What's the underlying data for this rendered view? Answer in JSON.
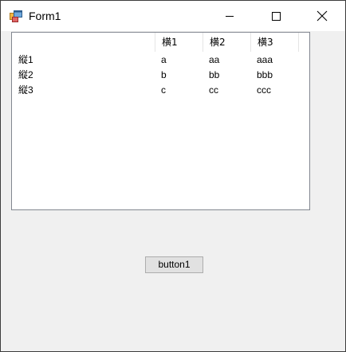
{
  "window": {
    "title": "Form1"
  },
  "listview": {
    "columns": [
      "",
      "横1",
      "横2",
      "横3"
    ],
    "rows": [
      [
        "縦1",
        "a",
        "aa",
        "aaa"
      ],
      [
        "縦2",
        "b",
        "bb",
        "bbb"
      ],
      [
        "縦3",
        "c",
        "cc",
        "ccc"
      ]
    ]
  },
  "button1": {
    "label": "button1"
  },
  "icons": {
    "app": "form-app-icon",
    "minimize": "minimize-icon",
    "maximize": "maximize-icon",
    "close": "close-icon"
  }
}
